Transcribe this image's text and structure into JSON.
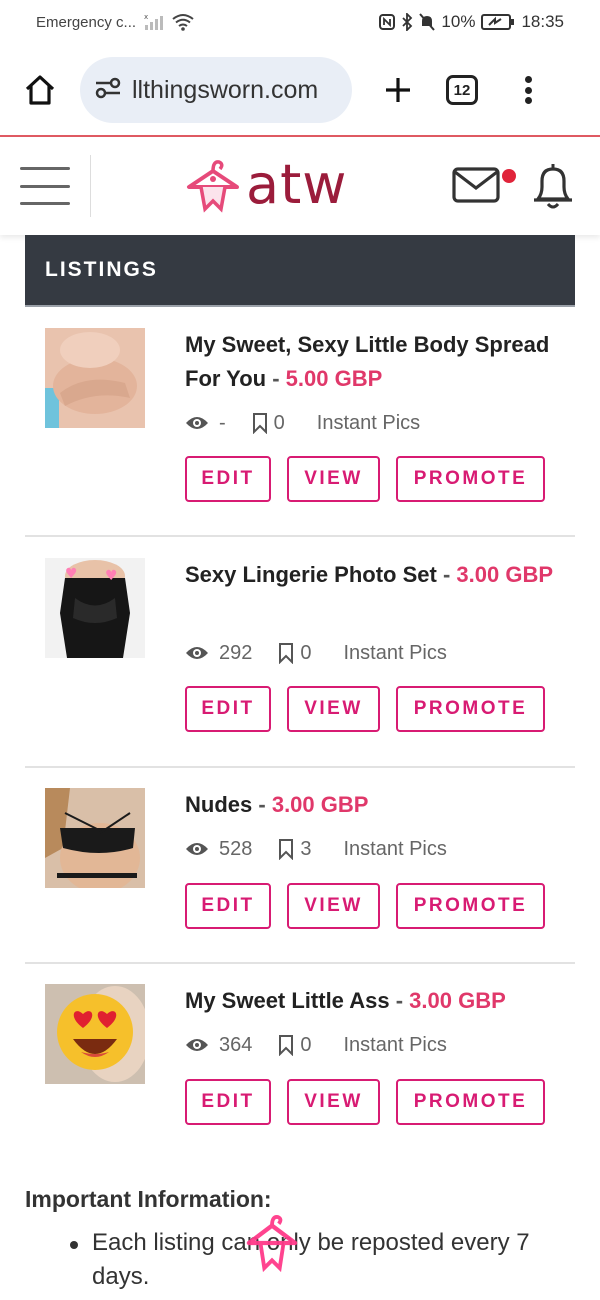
{
  "status_bar": {
    "carrier": "Emergency c...",
    "battery": "10%",
    "time": "18:35"
  },
  "browser": {
    "url": "llthingsworn.com",
    "tab_count": "12"
  },
  "site": {
    "logo_text": "atw",
    "accent_color": "#d81b73",
    "logo_color": "#9b1c3b"
  },
  "listings": {
    "heading": "LISTINGS",
    "separator": "-",
    "buttons": {
      "edit": "EDIT",
      "view": "VIEW",
      "promote": "PROMOTE"
    },
    "items": [
      {
        "title": "My Sweet, Sexy Little Body Spread For You",
        "price": "5.00 GBP",
        "views": "-",
        "saves": "0",
        "category": "Instant Pics"
      },
      {
        "title": "Sexy Lingerie Photo Set",
        "price": "3.00 GBP",
        "views": "292",
        "saves": "0",
        "category": "Instant Pics"
      },
      {
        "title": "Nudes",
        "price": "3.00 GBP",
        "views": "528",
        "saves": "3",
        "category": "Instant Pics"
      },
      {
        "title": "My Sweet Little Ass",
        "price": "3.00 GBP",
        "views": "364",
        "saves": "0",
        "category": "Instant Pics"
      }
    ]
  },
  "info": {
    "title": "Important Information:",
    "items": [
      "Each listing can only be reposted every 7 days."
    ]
  }
}
